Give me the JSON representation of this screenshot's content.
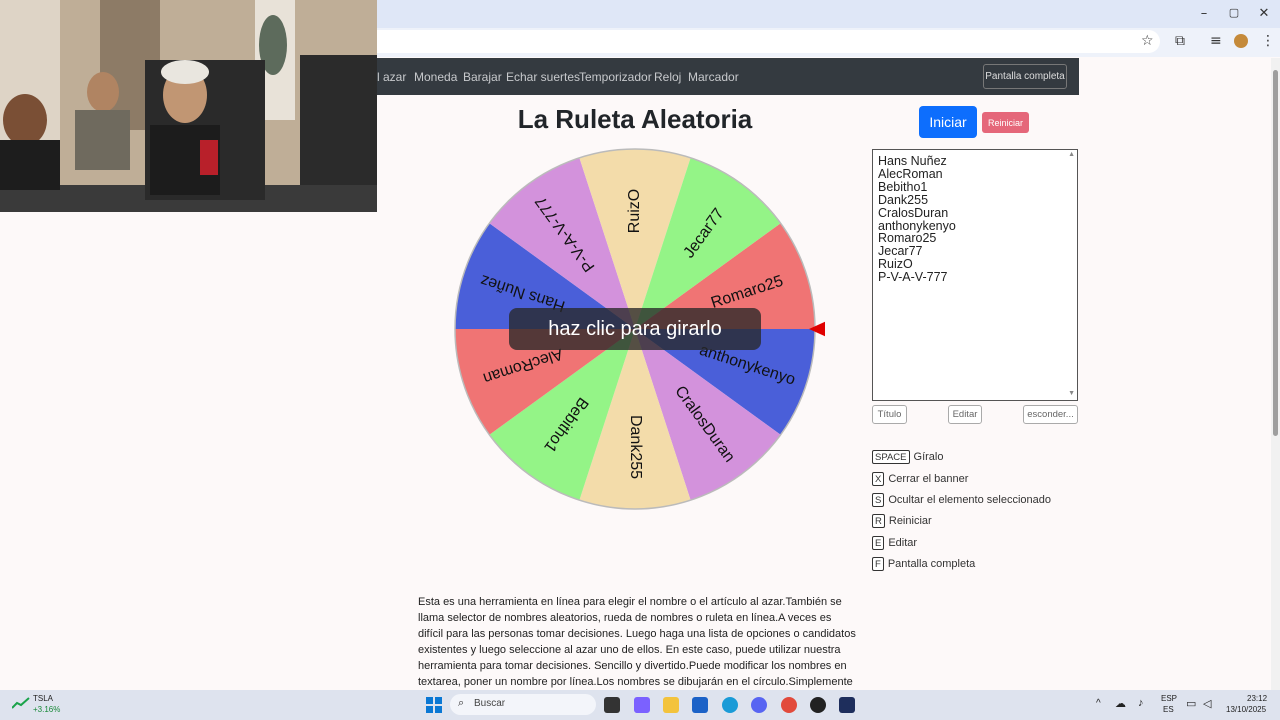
{
  "browser": {
    "window_controls": [
      "–",
      "▢",
      "✕"
    ],
    "toolbar_icons": [
      "star-icon",
      "extensions-icon",
      "media-icon",
      "profile-avatar",
      "menu-icon"
    ]
  },
  "nav": {
    "links": [
      "l azar",
      "Moneda",
      "Barajar",
      "Echar suertes",
      "Temporizador",
      "Reloj",
      "Marcador"
    ],
    "fullscreen_label": "Pantalla completa"
  },
  "page": {
    "title": "La Ruleta Aleatoria",
    "start_label": "Iniciar",
    "reset_label": "Reiniciar",
    "spin_overlay": "haz clic para girarlo"
  },
  "wheel": {
    "segments": [
      {
        "name": "Romaro25",
        "color": "#f07474"
      },
      {
        "name": "anthonykenyo",
        "color": "#4a5fd9"
      },
      {
        "name": "CralosDuran",
        "color": "#d392dc"
      },
      {
        "name": "Dank255",
        "color": "#f3dcaa"
      },
      {
        "name": "Bebitho1",
        "color": "#94f487"
      },
      {
        "name": "AlecRoman",
        "color": "#f07474"
      },
      {
        "name": "Hans Nuñez",
        "color": "#4a5fd9"
      },
      {
        "name": "P-V-A-V-777",
        "color": "#d392dc"
      },
      {
        "name": "RuizO",
        "color": "#f3dcaa"
      },
      {
        "name": "Jecar77",
        "color": "#94f487"
      }
    ],
    "pointer_color": "#e00000"
  },
  "names": [
    "Hans Nuñez",
    "AlecRoman",
    "Bebitho1",
    "Dank255",
    "CralosDuran",
    "anthonykenyo",
    "Romaro25",
    "Jecar77",
    "RuizO",
    "P-V-A-V-777"
  ],
  "actions": {
    "title": "Título",
    "edit": "Editar",
    "hide": "esconder..."
  },
  "shortcuts": [
    {
      "key": "SPACE",
      "label": "Gíralo"
    },
    {
      "key": "X",
      "label": "Cerrar el banner"
    },
    {
      "key": "S",
      "label": "Ocultar el elemento seleccionado"
    },
    {
      "key": "R",
      "label": "Reiniciar"
    },
    {
      "key": "E",
      "label": "Editar"
    },
    {
      "key": "F",
      "label": "Pantalla completa"
    }
  ],
  "description": "Esta es una herramienta en línea para elegir el nombre o el artículo al azar.También se llama selector de nombres aleatorios, rueda de nombres o ruleta en línea.A veces es difícil para las personas tomar decisiones. Luego haga una lista de opciones o candidatos existentes y luego seleccione al azar uno de ellos. En este caso, puede utilizar nuestra herramienta para tomar decisiones. Sencillo y divertido.Puede modificar los nombres en textarea, poner un nombre por línea.Los nombres se dibujarán en el círculo.Simplemente haga clic en la rueda",
  "taskbar": {
    "stock_symbol": "TSLA",
    "stock_change": "+3.16%",
    "search_placeholder": "Buscar",
    "lang_top": "ESP",
    "lang_bottom": "ES",
    "time": "23:12",
    "date": "13/10/2025"
  }
}
